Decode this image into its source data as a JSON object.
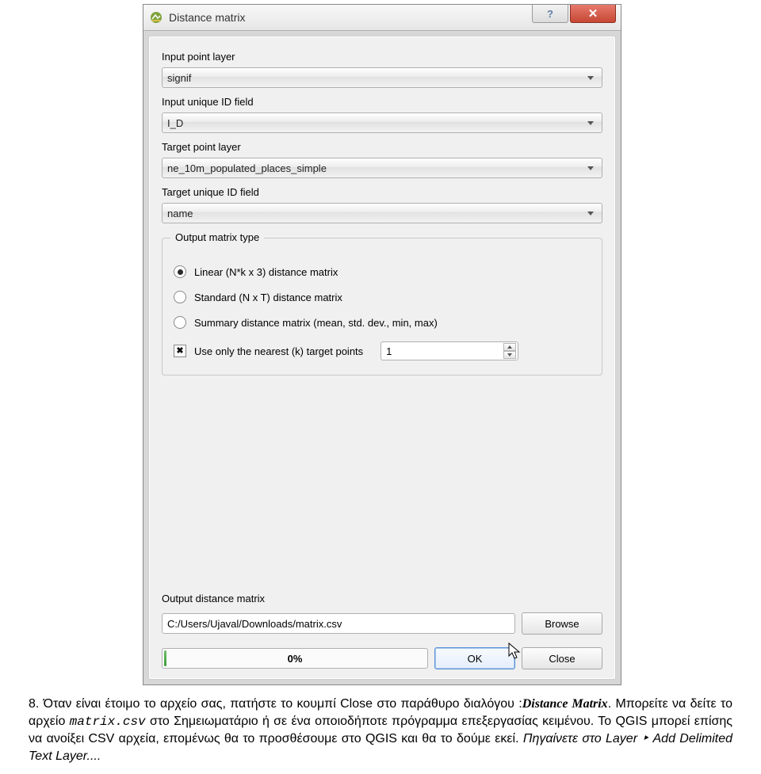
{
  "titlebar": {
    "title": "Distance matrix"
  },
  "fields": {
    "input_layer_label": "Input point layer",
    "input_layer_value": "signif",
    "input_id_label": "Input unique ID field",
    "input_id_value": "I_D",
    "target_layer_label": "Target point layer",
    "target_layer_value": "ne_10m_populated_places_simple",
    "target_id_label": "Target unique ID field",
    "target_id_value": "name"
  },
  "matrix_group": {
    "legend": "Output matrix type",
    "opt_linear": "Linear (N*k x 3) distance matrix",
    "opt_standard": "Standard (N x T) distance matrix",
    "opt_summary": "Summary distance matrix (mean, std. dev., min, max)",
    "nearest_label": "Use only the nearest (k) target points",
    "nearest_value": "1"
  },
  "output": {
    "label": "Output distance matrix",
    "path": "C:/Users/Ujaval/Downloads/matrix.csv",
    "browse": "Browse"
  },
  "progress_text": "0%",
  "buttons": {
    "ok": "OK",
    "close": "Close"
  },
  "caption": {
    "num": "8.",
    "l1a": "Όταν είναι έτοιμο το αρχείο σας, πατήστε το κουμπί Close στο παράθυρο διαλόγου :",
    "dm": "Distance Matrix",
    "l1b": ". Μπορείτε να δείτε το αρχείο ",
    "mcsv": "matrix.csv",
    "l1c": " στο Σημειωματάριο ή σε ένα οποιοδήποτε πρόγραμμα επεξεργασίας κειμένου. Το QGIS μπορεί επίσης να ανοίξει CSV αρχεία, επομένως θα το προσθέσουμε στο QGIS και θα το δούμε εκεί. ",
    "goto": "Πηγαίνετε στο Layer ‣ Add Delimited Text Layer...."
  }
}
